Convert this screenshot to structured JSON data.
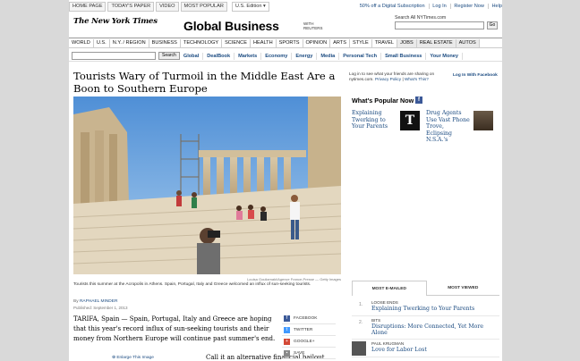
{
  "topbar": {
    "buttons": [
      "HOME PAGE",
      "TODAY'S PAPER",
      "VIDEO",
      "MOST POPULAR"
    ],
    "edition": "U.S. Edition ▾",
    "links": [
      "50% off a Digital Subscription",
      "Log In",
      "Register Now",
      "Help"
    ]
  },
  "masthead": {
    "logo": "The New York Times",
    "section": "Global Business",
    "with_reuters": "WITH\nREUTERS",
    "search_label": "Search All NYTimes.com",
    "go": "Go"
  },
  "nav": [
    "WORLD",
    "U.S.",
    "N.Y. / REGION",
    "BUSINESS",
    "TECHNOLOGY",
    "SCIENCE",
    "HEALTH",
    "SPORTS",
    "OPINION",
    "ARTS",
    "STYLE",
    "TRAVEL",
    "JOBS",
    "REAL ESTATE",
    "AUTOS"
  ],
  "subnav": {
    "search_button": "Search",
    "items": [
      "Global",
      "DealBook",
      "Markets",
      "Economy",
      "Energy",
      "Media",
      "Personal Tech",
      "Small Business",
      "Your Money"
    ]
  },
  "article": {
    "headline": "Tourists Wary of Turmoil in the Middle East Are a Boon to Southern Europe",
    "photo_credit": "Louisa Gouliamaki/Agence France-Presse — Getty Images",
    "caption": "Tourists this summer at the Acropolis in Athens. Spain, Portugal, Italy and Greece welcomed an influx of sun-seeking tourists.",
    "byline_prefix": "By",
    "byline_name": "RAPHAEL MINDER",
    "published": "Published: September 1, 2013",
    "body1": "TARIFA, Spain — Spain, Portugal, Italy and Greece are hoping that this year's record influx of sun-seeking tourists and their money from Northern Europe will continue past summer's end.",
    "enlarge": "⊕ Enlarge This Image",
    "body2": "Call it an alternative financial bailout"
  },
  "share": [
    {
      "label": "FACEBOOK",
      "icon": "facebook-icon",
      "color": "#3b5998",
      "glyph": "f"
    },
    {
      "label": "TWITTER",
      "icon": "twitter-icon",
      "color": "#4099ff",
      "glyph": "t"
    },
    {
      "label": "GOOGLE+",
      "icon": "google-plus-icon",
      "color": "#d34836",
      "glyph": "+"
    },
    {
      "label": "SAVE",
      "icon": "save-icon",
      "color": "#888888",
      "glyph": "▪"
    }
  ],
  "sidebar": {
    "login_text_1": "Log in to see what your friends are sharing on nytimes.com.",
    "privacy": "Privacy Policy",
    "separator": "|",
    "whats_this": "What's This?",
    "login_fb": "Log In With Facebook",
    "whats_popular": "What's Popular Now",
    "popular": [
      {
        "headline": "Explaining Twerking to Your Parents"
      },
      {
        "headline": "Drug Agents Use Vast Phone Trove, Eclipsing N.S.A.'s"
      }
    ],
    "tabs": [
      "MOST E-MAILED",
      "MOST VIEWED"
    ],
    "most_list": [
      {
        "num": "1.",
        "kicker": "LOOSE ENDS",
        "headline": "Explaining Twerking to Your Parents"
      },
      {
        "num": "2.",
        "kicker": "BITS",
        "headline": "Disruptions: More Connected, Yet More Alone"
      },
      {
        "num": "",
        "kicker": "PAUL KRUGMAN",
        "headline": "Love for Labor Lost"
      }
    ]
  }
}
